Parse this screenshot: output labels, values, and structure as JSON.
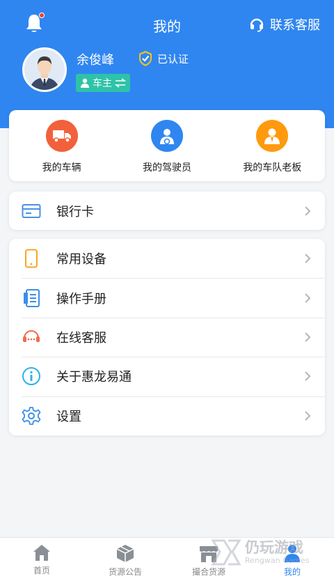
{
  "header": {
    "title": "我的",
    "customer_service": "联系客服"
  },
  "profile": {
    "name": "余俊峰",
    "verified_label": "已认证",
    "role_label": "车主"
  },
  "quick_actions": [
    {
      "label": "我的车辆",
      "icon": "truck-icon",
      "color": "#f2603c"
    },
    {
      "label": "我的驾驶员",
      "icon": "driver-icon",
      "color": "#2f86f0"
    },
    {
      "label": "我的车队老板",
      "icon": "boss-icon",
      "color": "#ff9a0e"
    }
  ],
  "bank": {
    "label": "银行卡"
  },
  "menu": [
    {
      "label": "常用设备",
      "icon": "phone-device-icon"
    },
    {
      "label": "操作手册",
      "icon": "manual-icon"
    },
    {
      "label": "在线客服",
      "icon": "headset-icon"
    },
    {
      "label": "关于惠龙易通",
      "icon": "info-icon"
    },
    {
      "label": "设置",
      "icon": "settings-gear-icon"
    }
  ],
  "tabs": [
    {
      "label": "首页",
      "icon": "home-icon",
      "active": false
    },
    {
      "label": "货源公告",
      "icon": "cargo-box-icon",
      "active": false
    },
    {
      "label": "撮合货源",
      "icon": "store-icon",
      "active": false
    },
    {
      "label": "我的",
      "icon": "profile-icon",
      "active": true
    }
  ],
  "watermark": {
    "title": "仍玩游戏",
    "subtitle": "Rengwan Games"
  },
  "colors": {
    "primary": "#2f86f0",
    "role_badge": "#2ec3a8"
  }
}
